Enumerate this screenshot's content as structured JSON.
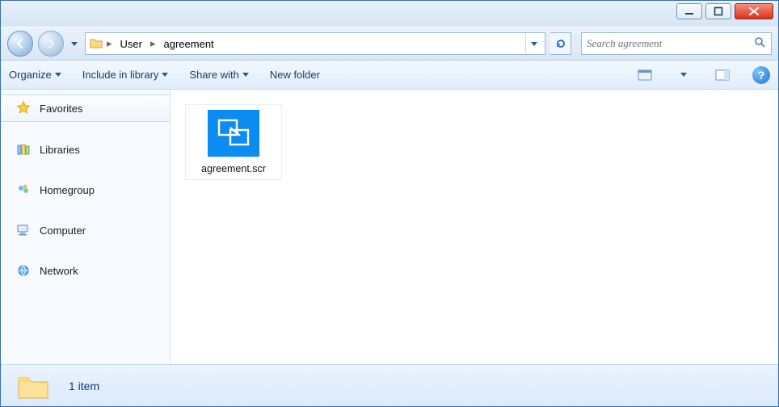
{
  "breadcrumb": {
    "root_icon": "folder-icon",
    "items": [
      "User",
      "agreement"
    ]
  },
  "search": {
    "placeholder": "Search agreement"
  },
  "toolbar": {
    "organize": "Organize",
    "include": "Include in library",
    "share": "Share with",
    "newfolder": "New folder"
  },
  "sidebar": {
    "items": [
      {
        "label": "Favorites",
        "icon": "star-icon",
        "selected": true
      },
      {
        "label": "Libraries",
        "icon": "libraries-icon",
        "selected": false
      },
      {
        "label": "Homegroup",
        "icon": "homegroup-icon",
        "selected": false
      },
      {
        "label": "Computer",
        "icon": "computer-icon",
        "selected": false
      },
      {
        "label": "Network",
        "icon": "network-icon",
        "selected": false
      }
    ]
  },
  "files": [
    {
      "name": "agreement.scr",
      "icon": "screensaver-icon"
    }
  ],
  "status": {
    "count_text": "1 item"
  }
}
